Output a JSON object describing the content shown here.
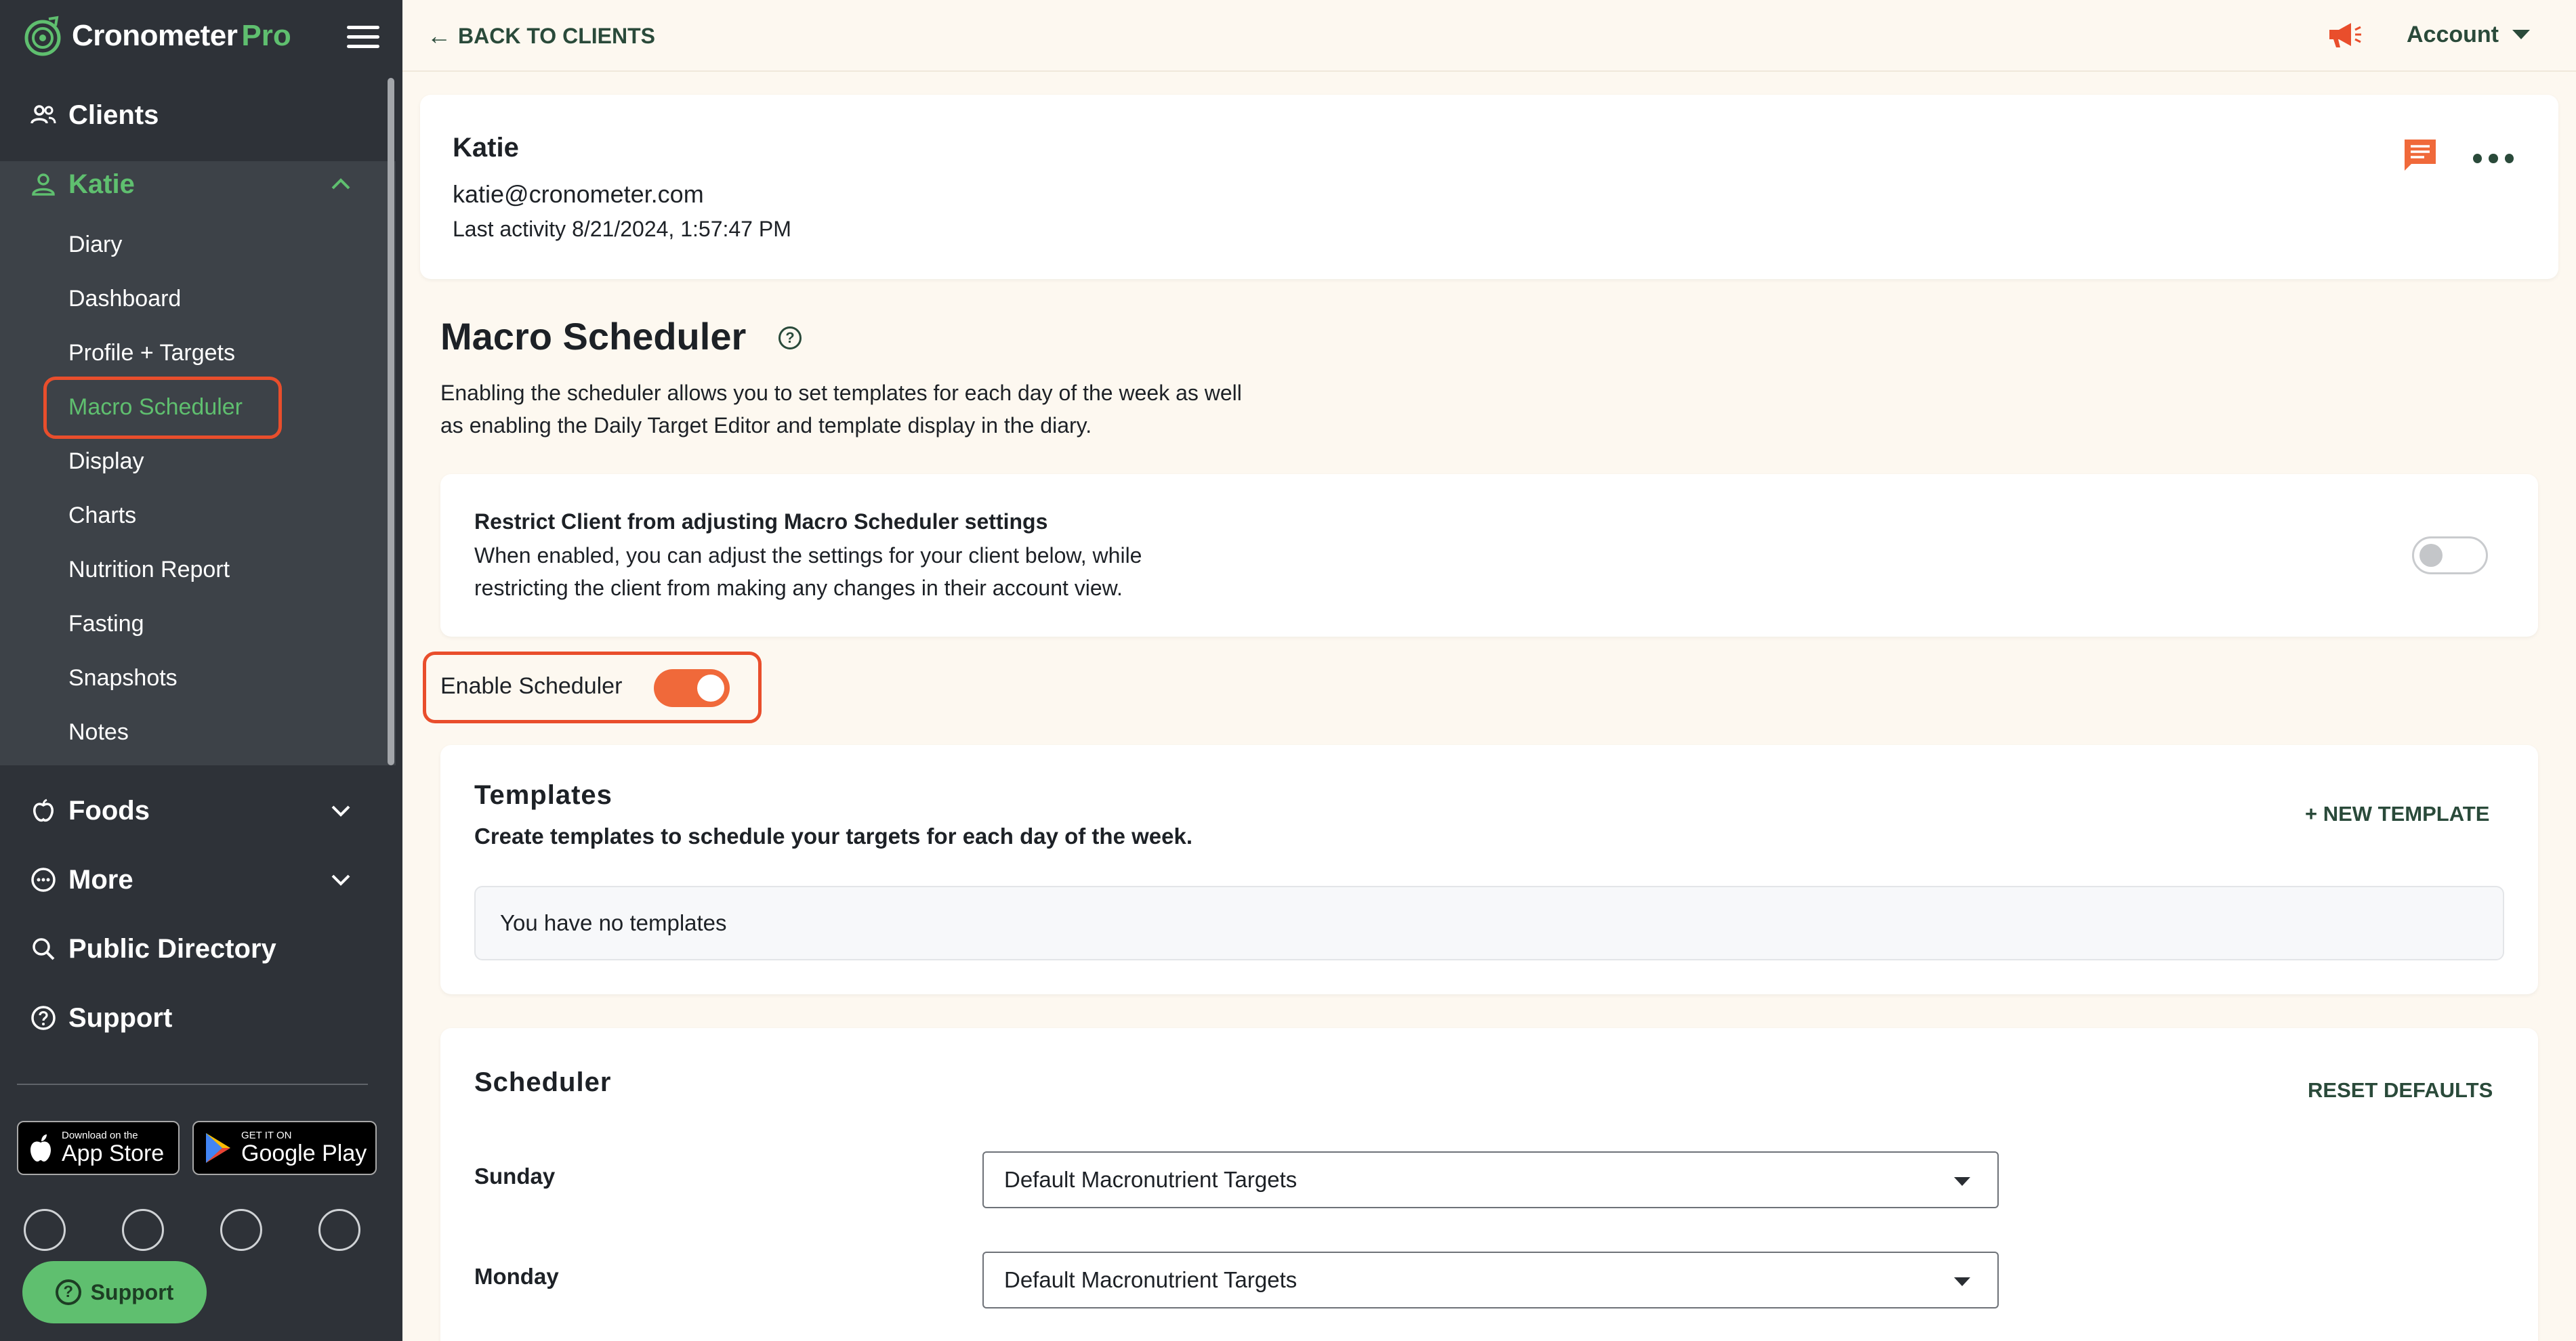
{
  "brand": {
    "name": "Cronometer",
    "suffix": "Pro",
    "accent": "#5fbf6f",
    "highlight": "#e94e2c",
    "toggle_on": "#f0693a"
  },
  "sidebar": {
    "clients_label": "Clients",
    "client_name": "Katie",
    "client_items": [
      "Diary",
      "Dashboard",
      "Profile + Targets",
      "Macro Scheduler",
      "Display",
      "Charts",
      "Nutrition Report",
      "Fasting",
      "Snapshots",
      "Notes"
    ],
    "active_item": "Macro Scheduler",
    "foods_label": "Foods",
    "more_label": "More",
    "public_directory_label": "Public Directory",
    "support_label": "Support",
    "app_store": {
      "small": "Download on the",
      "big": "App Store"
    },
    "google_play": {
      "small": "GET IT ON",
      "big": "Google Play"
    },
    "support_button": "Support"
  },
  "topbar": {
    "back_label": "BACK TO CLIENTS",
    "account_label": "Account"
  },
  "client": {
    "name": "Katie",
    "email": "katie@cronometer.com",
    "last_activity": "Last activity 8/21/2024, 1:57:47 PM"
  },
  "page": {
    "title": "Macro Scheduler",
    "description": "Enabling the scheduler allows you to set templates for each day of the week as well as enabling the Daily Target Editor and template display in the diary."
  },
  "restrict": {
    "title": "Restrict Client from adjusting Macro Scheduler settings",
    "description": "When enabled, you can adjust the settings for your client below, while restricting the client from making any changes in their account view.",
    "enabled": false
  },
  "enable_scheduler": {
    "label": "Enable Scheduler",
    "enabled": true
  },
  "templates": {
    "title": "Templates",
    "subtitle": "Create templates to schedule your targets for each day of the week.",
    "new_button": "+ NEW TEMPLATE",
    "empty_text": "You have no templates"
  },
  "scheduler": {
    "title": "Scheduler",
    "reset_button": "RESET DEFAULTS",
    "days": [
      {
        "day": "Sunday",
        "value": "Default Macronutrient Targets"
      },
      {
        "day": "Monday",
        "value": "Default Macronutrient Targets"
      }
    ]
  }
}
